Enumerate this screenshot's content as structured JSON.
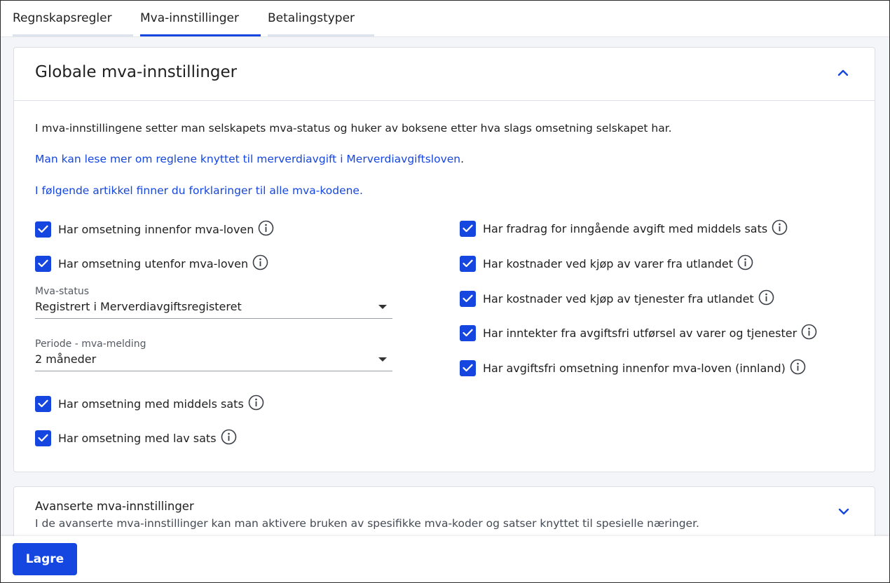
{
  "tabs": [
    {
      "label": "Regnskapsregler",
      "active": false
    },
    {
      "label": "Mva-innstillinger",
      "active": true
    },
    {
      "label": "Betalingstyper",
      "active": false
    }
  ],
  "global": {
    "title": "Globale mva-innstillinger",
    "intro": "I mva-innstillingene setter man selskapets mva-status og huker av boksene etter hva slags omsetning selskapet har.",
    "link1_text": "Man kan lese mer om reglene knyttet til merverdiavgift i Merverdiavgiftsloven",
    "link1_suffix": ".",
    "link2_text": "I følgende artikkel finner du forklaringer til alle mva-kodene",
    "link2_suffix": ".",
    "left_checkboxes_top": [
      {
        "label": "Har omsetning innenfor mva-loven",
        "checked": true
      },
      {
        "label": "Har omsetning utenfor mva-loven",
        "checked": true
      }
    ],
    "mva_status": {
      "label": "Mva-status",
      "value": "Registrert i Merverdiavgiftsregisteret"
    },
    "periode": {
      "label": "Periode - mva-melding",
      "value": "2 måneder"
    },
    "left_checkboxes_bottom": [
      {
        "label": "Har omsetning med middels sats",
        "checked": true
      },
      {
        "label": "Har omsetning med lav sats",
        "checked": true
      }
    ],
    "right_checkboxes": [
      {
        "label": "Har fradrag for inngående avgift med middels sats",
        "checked": true
      },
      {
        "label": "Har kostnader ved kjøp av varer fra utlandet",
        "checked": true
      },
      {
        "label": "Har kostnader ved kjøp av tjenester fra utlandet",
        "checked": true
      },
      {
        "label": "Har inntekter fra avgiftsfri utførsel av varer og tjenester",
        "checked": true
      },
      {
        "label": "Har avgiftsfri omsetning innenfor mva-loven (innland)",
        "checked": true
      }
    ]
  },
  "advanced": {
    "title": "Avanserte mva-innstillinger",
    "description": "I de avanserte mva-innstillinger kan man aktivere bruken av spesifikke mva-koder og satser knyttet til spesielle næringer."
  },
  "footer": {
    "save_label": "Lagre"
  },
  "colors": {
    "accent": "#1546e0",
    "background": "#f3f5f9"
  }
}
